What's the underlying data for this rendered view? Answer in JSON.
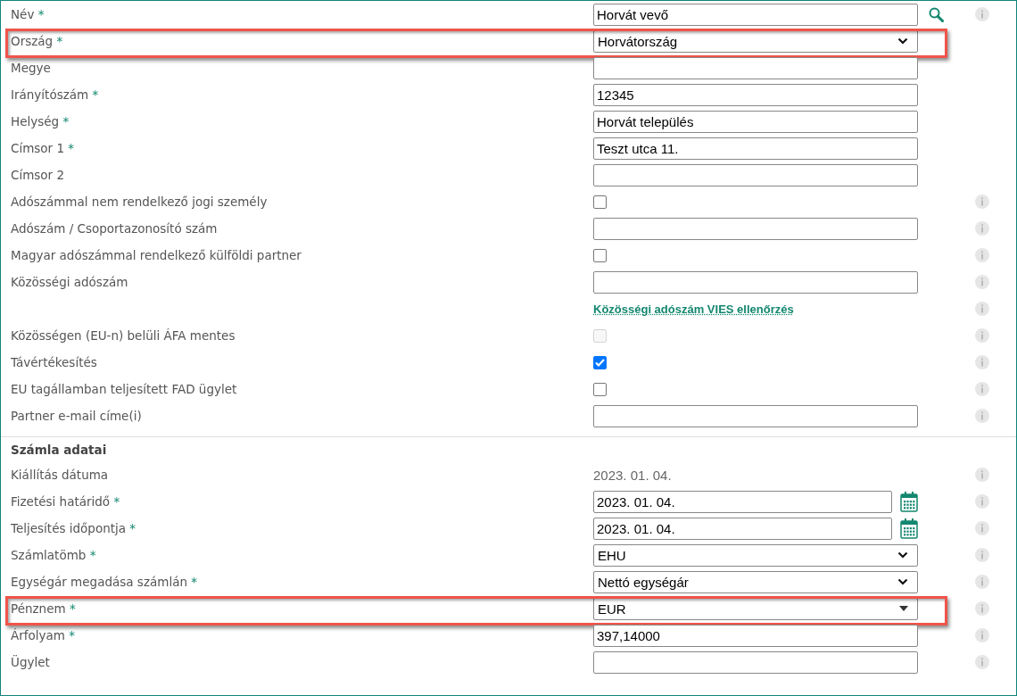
{
  "fields": [
    {
      "kind": "text",
      "label": "Név",
      "mark": "*",
      "value": "Horvát vevő",
      "search": true,
      "info": true,
      "highlighted": false
    },
    {
      "kind": "select",
      "label": "Ország",
      "mark": "*",
      "value": "Horvátország",
      "info": false,
      "highlighted": true
    },
    {
      "kind": "text",
      "label": "Megye",
      "info": false,
      "highlighted": false
    },
    {
      "kind": "text",
      "label": "Irányítószám",
      "mark": "*",
      "value": "12345",
      "info": false,
      "highlighted": false
    },
    {
      "kind": "text",
      "label": "Helység",
      "mark": "*",
      "value": "Horvát település",
      "info": false,
      "highlighted": false
    },
    {
      "kind": "text",
      "label": "Címsor 1",
      "mark": "*",
      "value": "Teszt utca 11.",
      "info": false,
      "highlighted": false
    },
    {
      "kind": "text",
      "label": "Címsor 2",
      "info": false,
      "highlighted": false
    },
    {
      "kind": "checkbox",
      "label": "Adószámmal nem rendelkező jogi személy",
      "checked": false,
      "disabled": false,
      "info": true,
      "highlighted": false
    },
    {
      "kind": "text",
      "label": "Adószám / Csoportazonosító szám",
      "info": true,
      "highlighted": false
    },
    {
      "kind": "checkbox",
      "label": "Magyar adószámmal rendelkező külföldi partner",
      "checked": false,
      "disabled": false,
      "info": true,
      "highlighted": false
    },
    {
      "kind": "text",
      "label": "Közösségi adószám",
      "info": true,
      "highlighted": false
    },
    {
      "kind": "link",
      "text": "Közösségi adószám VIES ellenőrzés",
      "info": true,
      "highlighted": false
    },
    {
      "kind": "checkbox",
      "label": "Közösségen (EU-n) belüli ÁFA mentes",
      "checked": false,
      "disabled": true,
      "info": true,
      "highlighted": false
    },
    {
      "kind": "checkbox",
      "label": "Távértékesítés",
      "checked": true,
      "disabled": false,
      "info": true,
      "highlighted": false
    },
    {
      "kind": "checkbox",
      "label": "EU tagállamban teljesített FAD ügylet",
      "checked": false,
      "disabled": false,
      "info": true,
      "highlighted": false
    },
    {
      "kind": "text",
      "label": "Partner e-mail címe(i)",
      "info": true,
      "highlighted": false
    }
  ],
  "invoice": {
    "title": "Számla adatai",
    "fields": [
      {
        "kind": "static",
        "label": "Kiállítás dátuma",
        "value": "2023. 01. 04.",
        "info": true,
        "highlighted": false
      },
      {
        "kind": "date",
        "label": "Fizetési határidő",
        "mark": "*",
        "value": "2023. 01. 04.",
        "info": true,
        "highlighted": false
      },
      {
        "kind": "date",
        "label": "Teljesítés időpontja",
        "mark": "*",
        "value": "2023. 01. 04.",
        "info": true,
        "highlighted": false
      },
      {
        "kind": "select",
        "label": "Számlatömb",
        "mark": "*",
        "value": "EHU",
        "info": true,
        "highlighted": false
      },
      {
        "kind": "select",
        "label": "Egységár megadása számlán",
        "mark": "*",
        "value": "Nettó egységár",
        "info": true,
        "highlighted": false
      },
      {
        "kind": "combo",
        "label": "Pénznem",
        "mark": "*",
        "value": "EUR",
        "info": true,
        "highlighted": true
      },
      {
        "kind": "text",
        "label": "Árfolyam",
        "mark": "*",
        "value": "397,14000",
        "info": true,
        "highlighted": false
      },
      {
        "kind": "text",
        "label": "Ügylet",
        "info": true,
        "highlighted": false
      }
    ]
  }
}
